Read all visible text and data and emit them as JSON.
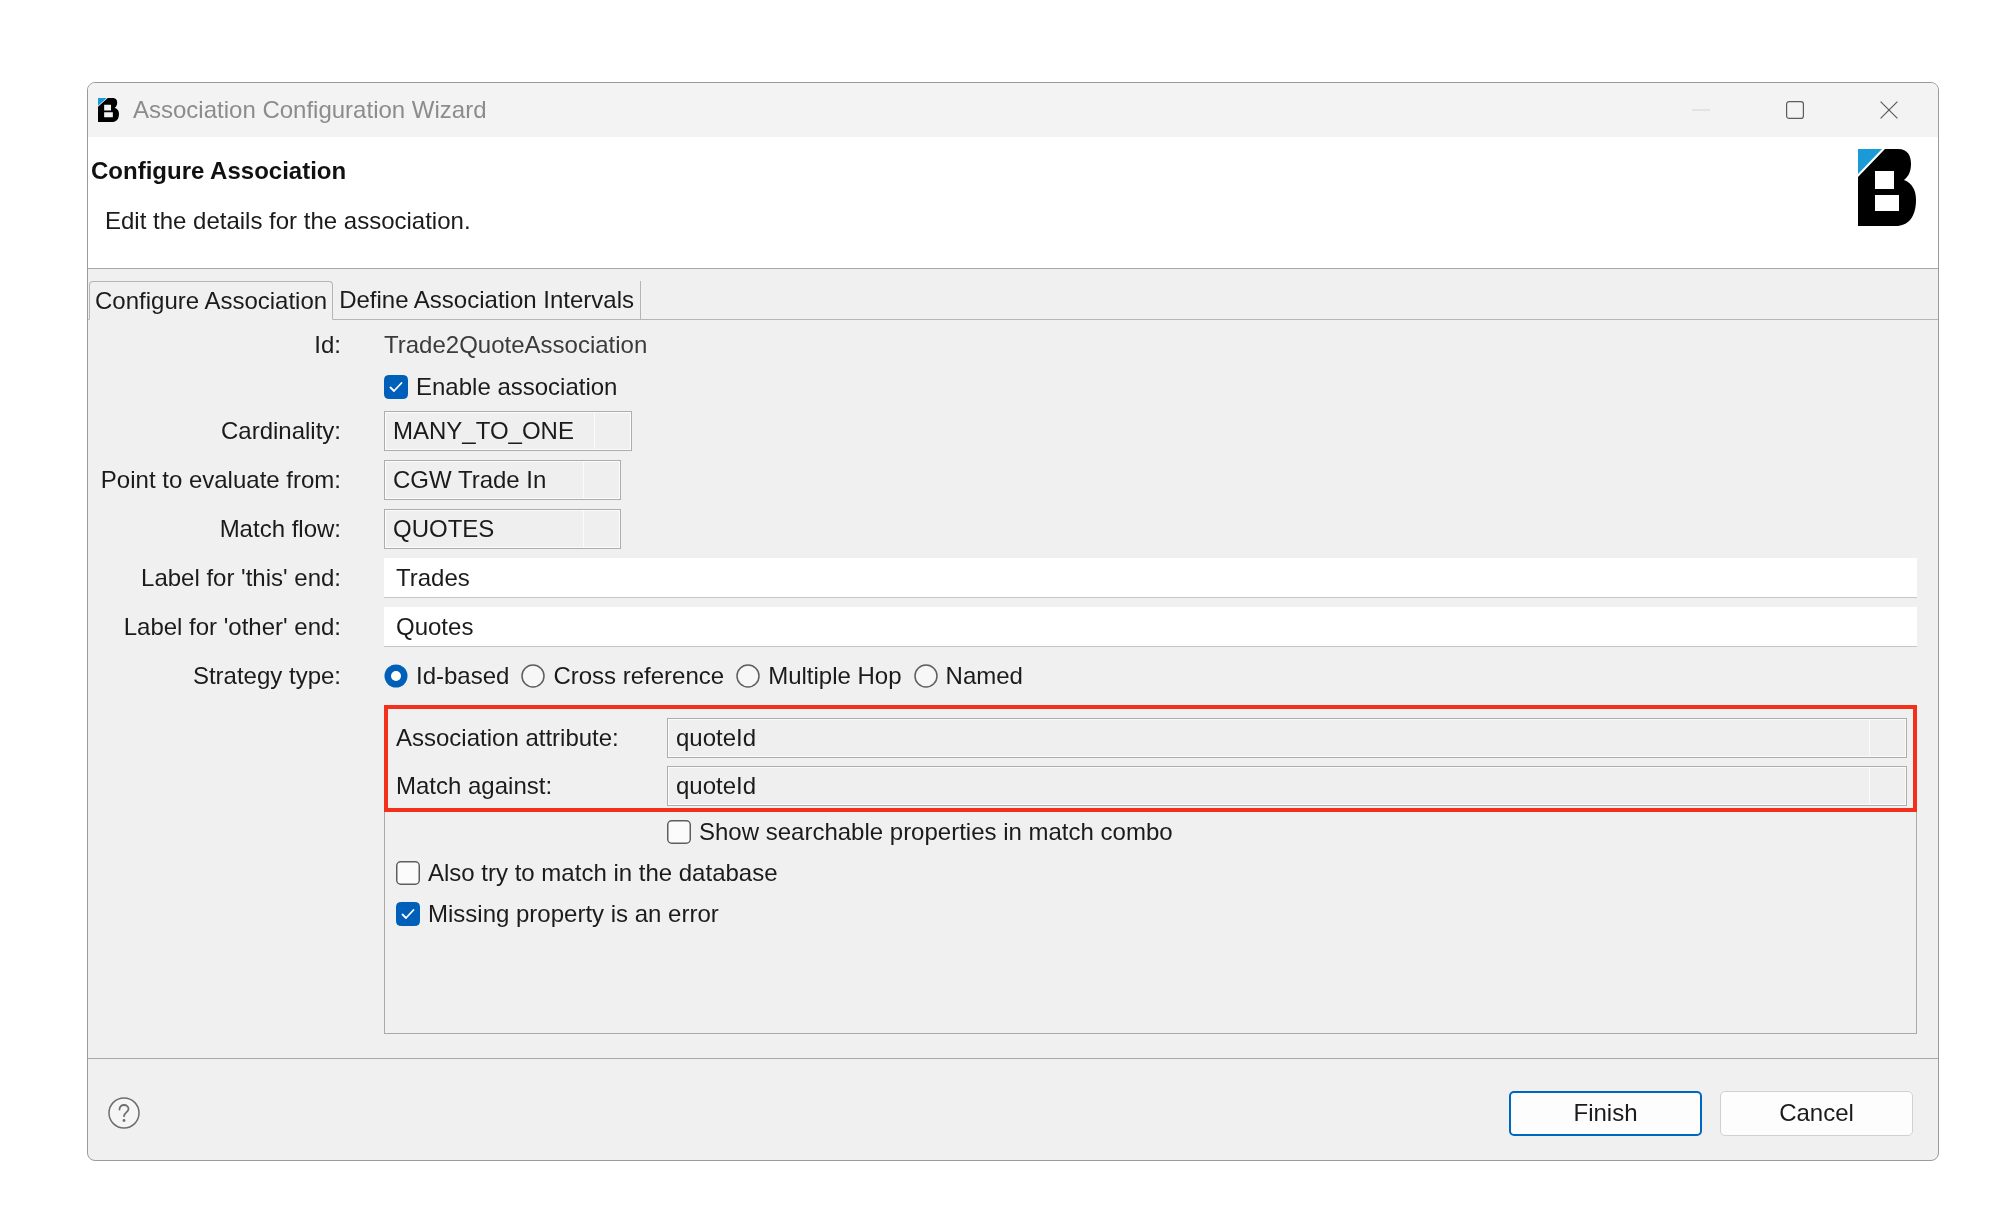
{
  "window": {
    "title": "Association Configuration Wizard"
  },
  "header": {
    "title": "Configure Association",
    "description": "Edit the details for the association."
  },
  "tabs": [
    {
      "label": "Configure Association",
      "selected": true
    },
    {
      "label": "Define Association Intervals",
      "selected": false
    }
  ],
  "form": {
    "rows": [
      {
        "kind": "text",
        "label": "Id:",
        "value": "Trade2QuoteAssociation"
      },
      {
        "kind": "checkbox",
        "label": "Enable association",
        "checked": true
      },
      {
        "kind": "combo",
        "label": "Cardinality:",
        "value": "MANY_TO_ONE"
      },
      {
        "kind": "combo",
        "label": "Point to evaluate from:",
        "value": "CGW Trade In"
      },
      {
        "kind": "combo",
        "label": "Match flow:",
        "value": "QUOTES"
      },
      {
        "kind": "input",
        "label": "Label for 'this' end:",
        "value": "Trades"
      },
      {
        "kind": "input",
        "label": "Label for 'other' end:",
        "value": "Quotes"
      },
      {
        "kind": "radio",
        "label": "Strategy type:",
        "options": [
          {
            "label": "Id-based",
            "selected": true
          },
          {
            "label": "Cross reference",
            "selected": false
          },
          {
            "label": "Multiple Hop",
            "selected": false
          },
          {
            "label": "Named",
            "selected": false
          }
        ]
      }
    ]
  },
  "strategy_panel": {
    "highlighted": true,
    "fields": [
      {
        "label": "Association attribute:",
        "value": "quoteId"
      },
      {
        "label": "Match against:",
        "value": "quoteId"
      }
    ],
    "match_option": {
      "label": "Show searchable properties in match combo",
      "checked": false
    },
    "checkboxes": [
      {
        "label": "Also try to match in the database",
        "checked": false
      },
      {
        "label": "Missing property is an error",
        "checked": true
      }
    ]
  },
  "buttons": [
    {
      "label": "Finish",
      "default": true
    },
    {
      "label": "Cancel",
      "default": false
    }
  ]
}
